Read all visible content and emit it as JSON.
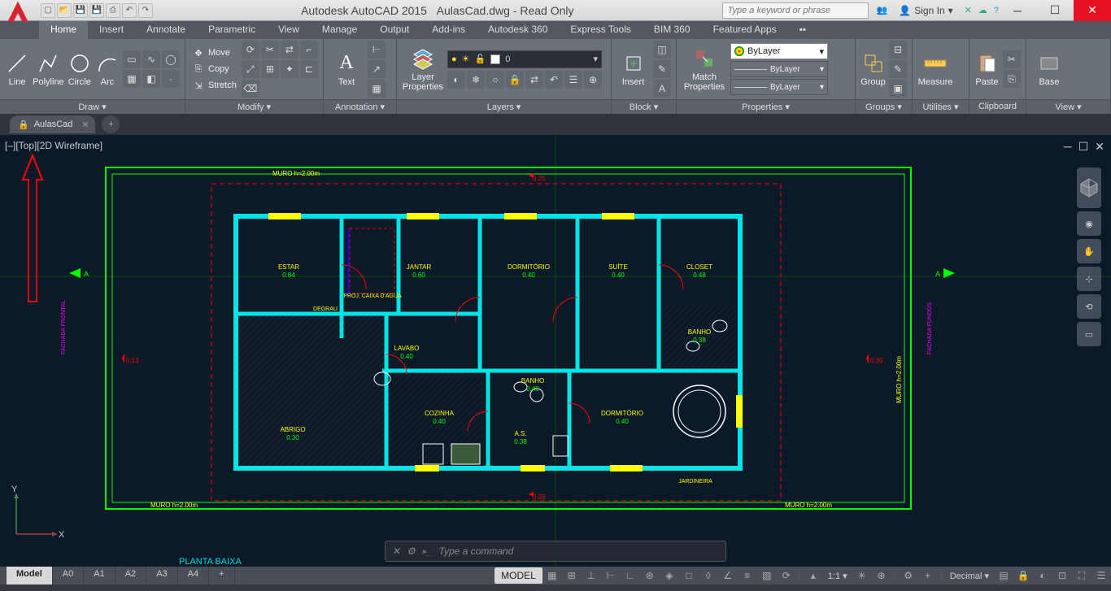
{
  "title": {
    "app": "Autodesk AutoCAD 2015",
    "file": "AulasCad.dwg - Read Only"
  },
  "search_placeholder": "Type a keyword or phrase",
  "signin": "Sign In",
  "tabs": [
    "Home",
    "Insert",
    "Annotate",
    "Parametric",
    "View",
    "Manage",
    "Output",
    "Add-ins",
    "Autodesk 360",
    "Express Tools",
    "BIM 360",
    "Featured Apps"
  ],
  "active_tab": "Home",
  "panels": {
    "draw": {
      "title": "Draw ▾",
      "tools": [
        "Line",
        "Polyline",
        "Circle",
        "Arc"
      ]
    },
    "modify": {
      "title": "Modify ▾",
      "items": [
        "Move",
        "Copy",
        "Stretch"
      ]
    },
    "annotation": {
      "title": "Annotation ▾",
      "tool": "Text"
    },
    "layers": {
      "title": "Layers ▾",
      "tool": "Layer Properties",
      "current": "0"
    },
    "block": {
      "title": "Block ▾",
      "tool": "Insert"
    },
    "properties": {
      "title": "Properties ▾",
      "tool": "Match Properties",
      "layer": "ByLayer",
      "linetype": "ByLayer",
      "lineweight": "ByLayer"
    },
    "groups": {
      "title": "Groups ▾",
      "tool": "Group"
    },
    "utilities": {
      "title": "Utilities ▾",
      "tool": "Measure"
    },
    "clipboard": {
      "title": "Clipboard",
      "tool": "Paste"
    },
    "view": {
      "title": "View ▾",
      "tool": "Base"
    }
  },
  "filetab": "AulasCad",
  "viewport_label": "[–][Top][2D Wireframe]",
  "command_placeholder": "Type a command",
  "model_tabs": [
    "Model",
    "A0",
    "A1",
    "A2",
    "A3",
    "A4"
  ],
  "active_model_tab": "Model",
  "status": {
    "model": "MODEL",
    "scale": "1:1",
    "units": "Decimal"
  },
  "drawing": {
    "title": "PLANTA BAIXA",
    "muro": "MURO  h=2.00m",
    "rooms": [
      {
        "name": "ESTAR",
        "dim": "0.84"
      },
      {
        "name": "JANTAR",
        "dim": "0.60"
      },
      {
        "name": "DORMITÓRIO",
        "dim": "0.40"
      },
      {
        "name": "SUÍTE",
        "dim": "0.40"
      },
      {
        "name": "CLOSET",
        "dim": "0.48"
      },
      {
        "name": "LAVABO",
        "dim": "0.40"
      },
      {
        "name": "COZINHA",
        "dim": "0.40"
      },
      {
        "name": "BANHO",
        "dim": "0.40"
      },
      {
        "name": "A.S.",
        "dim": "0.38"
      },
      {
        "name": "DORMITÓRIO",
        "dim": "0.40"
      },
      {
        "name": "BANHO",
        "dim": "0.38"
      },
      {
        "name": "ABRIGO",
        "dim": "0.30"
      }
    ],
    "dims": {
      "ext_h": "0.25",
      "ext_v": "0.13",
      "ext_r": "0.30"
    },
    "labels": {
      "facl": "FACHADA FRONTAL",
      "facr": "FACHADA FUNDOS",
      "proj": "PROJ. CAIXA D'AGUA",
      "deg": "DEGRAU",
      "jard": "JARDINEIRA",
      "a": "A"
    }
  }
}
